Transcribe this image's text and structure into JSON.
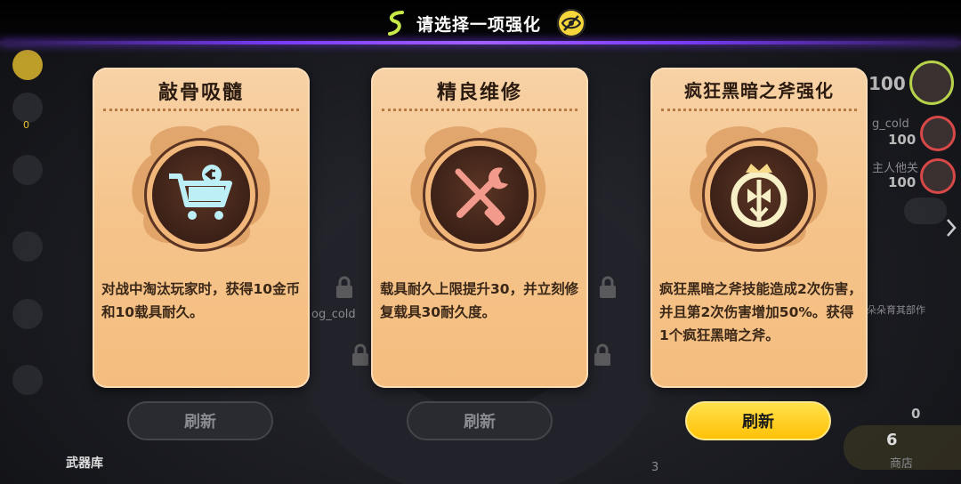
{
  "header": {
    "title": "请选择一项强化",
    "hide_icon": "eye-slash-icon"
  },
  "cards": [
    {
      "title": "敲骨吸髓",
      "icon": "shopping-cart-icon",
      "description": "对战中淘汰玩家时，获得10金币和10载具耐久。",
      "refresh_label": "刷新",
      "refresh_enabled": false
    },
    {
      "title": "精良维修",
      "icon": "wrench-screwdriver-icon",
      "description": "载具耐久上限提升30，并立刻修复载具30耐久度。",
      "refresh_label": "刷新",
      "refresh_enabled": false
    },
    {
      "title": "疯狂黑暗之斧强化",
      "icon": "crowned-axe-emblem-icon",
      "description": "疯狂黑暗之斧技能造成2次伤害，并且第2次伤害增加50%。获得1个疯狂黑暗之斧。",
      "refresh_label": "刷新",
      "refresh_enabled": true
    }
  ],
  "background": {
    "player_score": "100",
    "player2_name": "g_cold",
    "player2_score": "100",
    "player3_name": "主人他关",
    "player3_score": "100",
    "bg_name": "og_cold",
    "bg_group": "朵朵育其部作",
    "arsenal_label": "武器库",
    "shop_label": "商店",
    "coins": "6",
    "kills": "0",
    "left_counter": "0",
    "bottom_number": "3"
  },
  "colors": {
    "accent_purple": "#7c3cff",
    "refresh_active": "#ffd22e",
    "card_bg": "#f5c48c"
  }
}
